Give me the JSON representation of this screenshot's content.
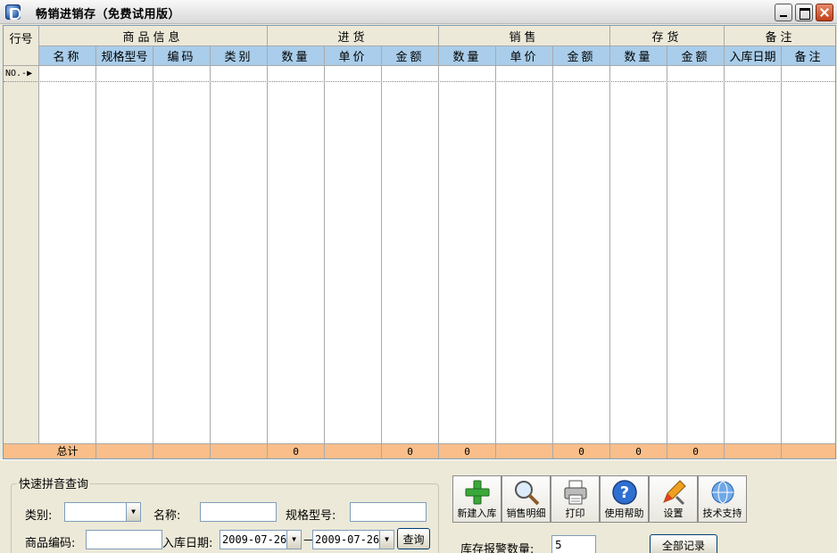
{
  "window": {
    "title": "畅销进销存（免费试用版）"
  },
  "grid": {
    "row_no_header": "行号",
    "groups": [
      "商品信息",
      "进货",
      "销售",
      "存货",
      "备注"
    ],
    "columns": [
      "名称",
      "规格型号",
      "编码",
      "类别",
      "数量",
      "单价",
      "金额",
      "数量",
      "单价",
      "金额",
      "数量",
      "金额",
      "入库日期",
      "备注"
    ],
    "current_row_marker": "NO.-▶",
    "total_label": "总计",
    "totals": [
      "0",
      "0",
      "0",
      "0",
      "0",
      "0"
    ]
  },
  "search": {
    "title": "快速拼音查询",
    "category_label": "类别:",
    "category_value": "",
    "name_label": "名称:",
    "name_value": "",
    "spec_label": "规格型号:",
    "spec_value": "",
    "code_label": "商品编码:",
    "code_value": "",
    "date_label": "入库日期:",
    "date_from": "2009-07-26",
    "date_sep": "—",
    "date_to": "2009-07-26",
    "query_button": "查询"
  },
  "toolbar": {
    "new_stock": "新建入库",
    "sales_detail": "销售明细",
    "print": "打印",
    "help": "使用帮助",
    "settings": "设置",
    "support": "技术支持"
  },
  "alarm": {
    "label": "库存报警数量:",
    "value": "5"
  },
  "all_records_button": "全部记录",
  "colors": {
    "header_blue": "#a9cdea",
    "total_orange": "#f9be8a",
    "background": "#ece9d8"
  }
}
